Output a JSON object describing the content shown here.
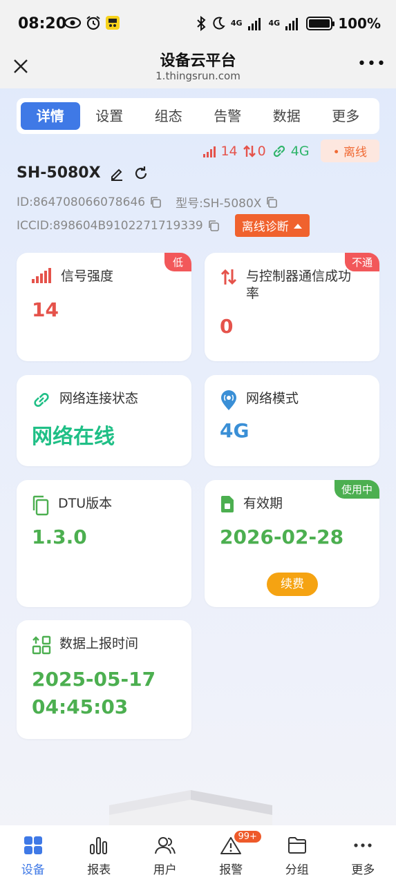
{
  "statusbar": {
    "time": "08:20",
    "network_1": "4G",
    "network_2": "4G",
    "battery": "100%"
  },
  "header": {
    "title": "设备云平台",
    "subtitle": "1.thingsrun.com",
    "more_label": "•••"
  },
  "tabs": [
    {
      "label": "详情",
      "active": true
    },
    {
      "label": "设置",
      "active": false
    },
    {
      "label": "组态",
      "active": false
    },
    {
      "label": "告警",
      "active": false
    },
    {
      "label": "数据",
      "active": false
    },
    {
      "label": "更多",
      "active": false
    }
  ],
  "status": {
    "signal": "14",
    "comm": "0",
    "network": "4G",
    "offline_label": "• 离线"
  },
  "device": {
    "name": "SH-5080X",
    "id": "ID:864708066078646",
    "model": "型号:SH-5080X",
    "iccid": "ICCID:898604B9102271719339",
    "diag_button": "离线诊断"
  },
  "cards": {
    "signal": {
      "label": "信号强度",
      "value": "14",
      "badge": "低"
    },
    "comm_rate": {
      "label": "与控制器通信成功率",
      "value": "0",
      "badge": "不通"
    },
    "net_state": {
      "label": "网络连接状态",
      "value": "网络在线"
    },
    "net_mode": {
      "label": "网络模式",
      "value": "4G"
    },
    "dtu": {
      "label": "DTU版本",
      "value": "1.3.0"
    },
    "validity": {
      "label": "有效期",
      "value": "2026-02-28",
      "badge": "使用中",
      "renew": "续费"
    },
    "report_time": {
      "label": "数据上报时间",
      "value_date": "2025-05-17",
      "value_time": "04:45:03"
    }
  },
  "bottom_nav": [
    {
      "label": "设备",
      "active": true
    },
    {
      "label": "报表",
      "active": false
    },
    {
      "label": "用户",
      "active": false
    },
    {
      "label": "报警",
      "active": false,
      "badge": "99+"
    },
    {
      "label": "分组",
      "active": false
    },
    {
      "label": "更多",
      "active": false
    }
  ],
  "colors": {
    "accent": "#3f79e6",
    "red": "#e5534b",
    "green": "#2fb46a",
    "value_green": "#4caf50",
    "teal": "#1fbf86",
    "blue": "#3a8fd6",
    "orange": "#f0622e"
  }
}
